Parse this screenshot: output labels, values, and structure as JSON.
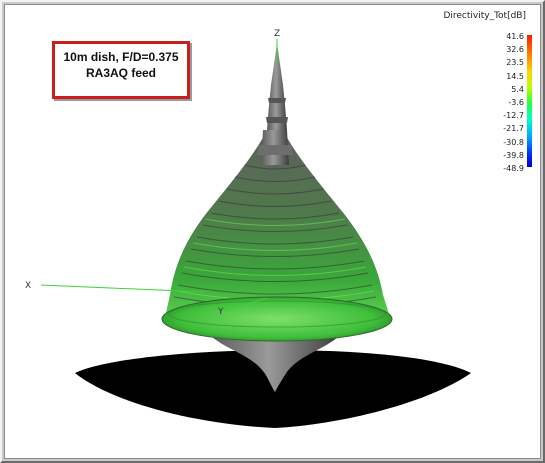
{
  "annotation": {
    "line1": "10m dish, F/D=0.375",
    "line2": "RA3AQ feed"
  },
  "legend": {
    "title": "Directivity_Tot[dB]",
    "values": [
      "41.6",
      "32.6",
      "23.5",
      "14.5",
      "5.4",
      "-3.6",
      "-12.7",
      "-21.7",
      "-30.8",
      "-39.8",
      "-48.9"
    ],
    "colors": [
      "#ff1a00",
      "#ff7a00",
      "#ffd800",
      "#b8ff00",
      "#21ff3a",
      "#00ffd0",
      "#00a8ff",
      "#0030ff",
      "#0000c8"
    ]
  },
  "axes": {
    "z": "Z",
    "x": "X",
    "y": "Y"
  },
  "colors": {
    "pattern_gray": "#6a6a6a",
    "pattern_green": "#3fbf3a",
    "shadow": "#000000",
    "frame_bg": "#c9c9c9"
  }
}
